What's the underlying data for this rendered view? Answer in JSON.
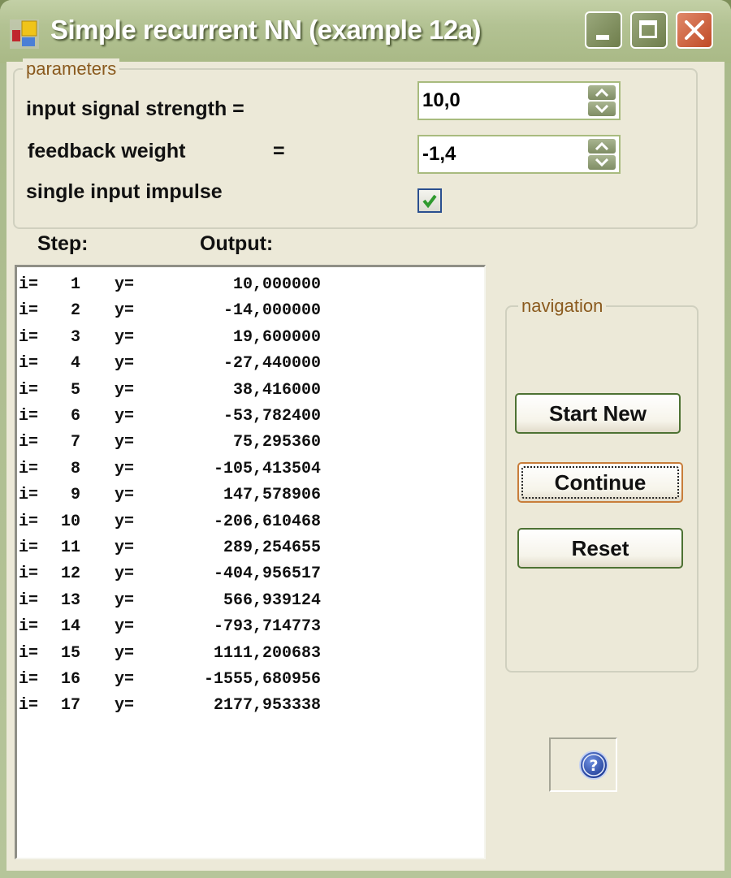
{
  "window": {
    "title": "Simple recurrent NN (example 12a)",
    "app_icon": "application-icon",
    "controls": {
      "minimize": "minimize-icon",
      "maximize": "maximize-icon",
      "close": "close-icon"
    }
  },
  "parameters": {
    "legend": "parameters",
    "input_signal_strength": {
      "label": "input signal strength =",
      "value": "10,0"
    },
    "feedback_weight": {
      "label": "feedback weight",
      "equals": "=",
      "value": "-1,4"
    },
    "single_input_impulse": {
      "label": "single input impulse",
      "checked": true
    }
  },
  "output": {
    "step_header": "Step:",
    "output_header": "Output:",
    "rows": [
      {
        "i_label": "i=",
        "step": "1",
        "y_label": "y=",
        "value": "10,000000"
      },
      {
        "i_label": "i=",
        "step": "2",
        "y_label": "y=",
        "value": "-14,000000"
      },
      {
        "i_label": "i=",
        "step": "3",
        "y_label": "y=",
        "value": "19,600000"
      },
      {
        "i_label": "i=",
        "step": "4",
        "y_label": "y=",
        "value": "-27,440000"
      },
      {
        "i_label": "i=",
        "step": "5",
        "y_label": "y=",
        "value": "38,416000"
      },
      {
        "i_label": "i=",
        "step": "6",
        "y_label": "y=",
        "value": "-53,782400"
      },
      {
        "i_label": "i=",
        "step": "7",
        "y_label": "y=",
        "value": "75,295360"
      },
      {
        "i_label": "i=",
        "step": "8",
        "y_label": "y=",
        "value": "-105,413504"
      },
      {
        "i_label": "i=",
        "step": "9",
        "y_label": "y=",
        "value": "147,578906"
      },
      {
        "i_label": "i=",
        "step": "10",
        "y_label": "y=",
        "value": "-206,610468"
      },
      {
        "i_label": "i=",
        "step": "11",
        "y_label": "y=",
        "value": "289,254655"
      },
      {
        "i_label": "i=",
        "step": "12",
        "y_label": "y=",
        "value": "-404,956517"
      },
      {
        "i_label": "i=",
        "step": "13",
        "y_label": "y=",
        "value": "566,939124"
      },
      {
        "i_label": "i=",
        "step": "14",
        "y_label": "y=",
        "value": "-793,714773"
      },
      {
        "i_label": "i=",
        "step": "15",
        "y_label": "y=",
        "value": "1111,200683"
      },
      {
        "i_label": "i=",
        "step": "16",
        "y_label": "y=",
        "value": "-1555,680956"
      },
      {
        "i_label": "i=",
        "step": "17",
        "y_label": "y=",
        "value": "2177,953338"
      }
    ]
  },
  "navigation": {
    "legend": "navigation",
    "start_new": "Start New",
    "continue": "Continue",
    "reset": "Reset",
    "focused_button": "continue"
  },
  "help": {
    "icon": "help-icon"
  },
  "colors": {
    "legend_text": "#8a5a1e",
    "titlebar": "#b3c293",
    "client_bg": "#ece9d8",
    "button_border": "#4d7233",
    "focus_border": "#c87d3a",
    "close_button": "#c04a26",
    "help_icon": "#2f4fa8"
  }
}
